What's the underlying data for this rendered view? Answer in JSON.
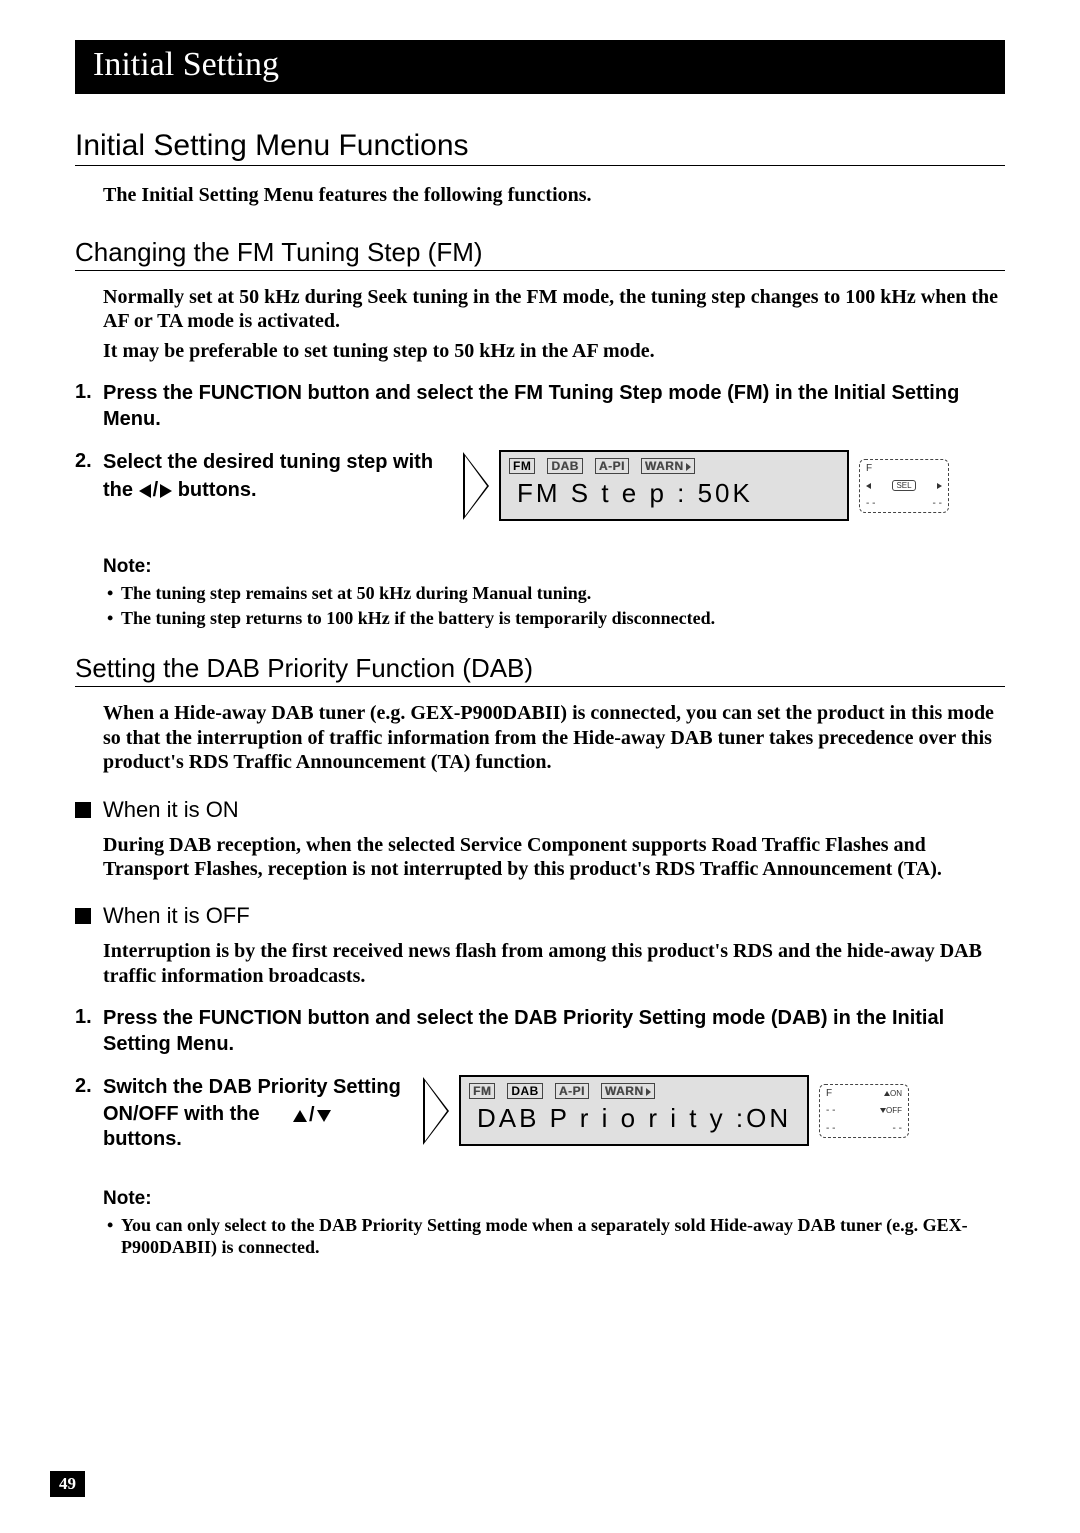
{
  "chapter_title": "Initial Setting",
  "section1_title": "Initial Setting Menu Functions",
  "section1_intro": "The Initial Setting Menu features the following functions.",
  "fm": {
    "heading": "Changing the FM Tuning Step (FM)",
    "para1": "Normally set at 50 kHz during Seek tuning in the FM mode, the tuning step changes to 100 kHz when the AF or TA mode is activated.",
    "para2": "It may be preferable to set tuning step to 50 kHz in the AF mode.",
    "step1_num": "1.",
    "step1": "Press the FUNCTION button and select the FM Tuning Step mode (FM) in the Initial Setting Menu.",
    "step2_num": "2.",
    "step2a": "Select the desired tuning step with the ",
    "step2b": " buttons.",
    "lcd_tags": {
      "fm": "FM",
      "dab": "DAB",
      "api": "A-PI",
      "warn": "WARN"
    },
    "lcd_text": "FM S t e p   :  50K",
    "lcd_side_f": "F",
    "lcd_side_sel": "SEL",
    "note_label": "Note:",
    "note1": "The tuning step remains set at 50 kHz during Manual tuning.",
    "note2": "The tuning step returns to 100 kHz if the battery is temporarily disconnected."
  },
  "dab": {
    "heading": "Setting the DAB Priority Function (DAB)",
    "intro": "When a Hide-away DAB tuner (e.g. GEX-P900DABII) is connected, you can set the product in this mode so that the interruption of traffic information from the Hide-away DAB tuner takes precedence over this product's RDS Traffic Announcement (TA) function.",
    "on_h": "When it is ON",
    "on_text": "During DAB reception, when the selected Service Component supports Road Traffic Flashes and Transport Flashes, reception is not interrupted by this product's RDS Traffic Announcement (TA).",
    "off_h": "When it is OFF",
    "off_text": "Interruption is by the first received news flash from among this product's RDS and the hide-away DAB traffic information broadcasts.",
    "step1_num": "1.",
    "step1": "Press the FUNCTION button and select the DAB Priority Setting mode (DAB) in the Initial Setting Menu.",
    "step2_num": "2.",
    "step2a": "Switch the DAB Priority Setting ON/OFF with the ",
    "step2b": "buttons.",
    "lcd_tags": {
      "fm": "FM",
      "dab": "DAB",
      "api": "A-PI",
      "warn": "WARN"
    },
    "lcd_text": "DAB P r i o r i t y :ON",
    "lcd_side_f": "F",
    "lcd_side_on": "ON",
    "lcd_side_off": "OFF",
    "note_label": "Note:",
    "note1": "You can only select to the DAB Priority Setting mode when a separately sold Hide-away DAB tuner (e.g. GEX-P900DABII) is connected."
  },
  "page_number": "49"
}
